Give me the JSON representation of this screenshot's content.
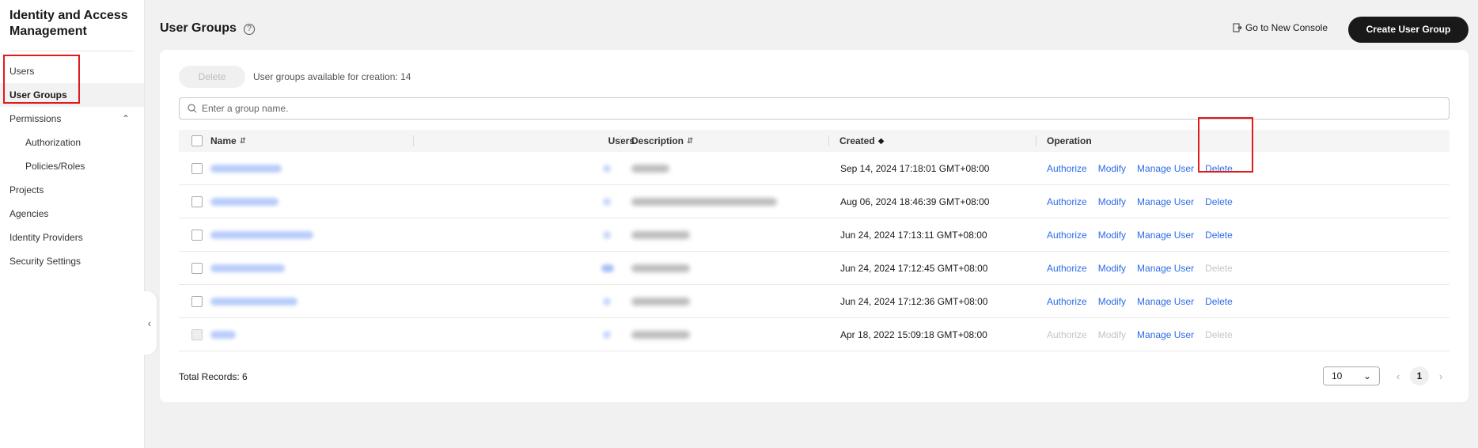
{
  "sidebar": {
    "title": "Identity and Access Management",
    "items": [
      {
        "label": "Users"
      },
      {
        "label": "User Groups"
      },
      {
        "label": "Permissions"
      },
      {
        "label": "Authorization"
      },
      {
        "label": "Policies/Roles"
      },
      {
        "label": "Projects"
      },
      {
        "label": "Agencies"
      },
      {
        "label": "Identity Providers"
      },
      {
        "label": "Security Settings"
      }
    ]
  },
  "header": {
    "title": "User Groups",
    "new_console": "Go to New Console",
    "create_button": "Create User Group"
  },
  "toolbar": {
    "delete_label": "Delete",
    "available": "User groups available for creation: 14"
  },
  "search": {
    "placeholder": "Enter a group name."
  },
  "table": {
    "columns": {
      "name": "Name",
      "users": "Users",
      "description": "Description",
      "created": "Created",
      "operation": "Operation"
    },
    "rows": [
      {
        "created": "Sep 14, 2024 17:18:01 GMT+08:00",
        "ops": [
          "Authorize",
          "Modify",
          "Manage User",
          "Delete"
        ],
        "disabled": [
          false,
          false,
          false,
          false
        ]
      },
      {
        "created": "Aug 06, 2024 18:46:39 GMT+08:00",
        "ops": [
          "Authorize",
          "Modify",
          "Manage User",
          "Delete"
        ],
        "disabled": [
          false,
          false,
          false,
          false
        ]
      },
      {
        "created": "Jun 24, 2024 17:13:11 GMT+08:00",
        "ops": [
          "Authorize",
          "Modify",
          "Manage User",
          "Delete"
        ],
        "disabled": [
          false,
          false,
          false,
          false
        ]
      },
      {
        "created": "Jun 24, 2024 17:12:45 GMT+08:00",
        "ops": [
          "Authorize",
          "Modify",
          "Manage User",
          "Delete"
        ],
        "disabled": [
          false,
          false,
          false,
          true
        ]
      },
      {
        "created": "Jun 24, 2024 17:12:36 GMT+08:00",
        "ops": [
          "Authorize",
          "Modify",
          "Manage User",
          "Delete"
        ],
        "disabled": [
          false,
          false,
          false,
          false
        ]
      },
      {
        "created": "Apr 18, 2022 15:09:18 GMT+08:00",
        "ops": [
          "Authorize",
          "Modify",
          "Manage User",
          "Delete"
        ],
        "disabled": [
          true,
          true,
          false,
          true
        ]
      }
    ]
  },
  "footer": {
    "total": "Total Records: 6",
    "page_size": "10",
    "current_page": "1"
  },
  "colors": {
    "accent": "#2d6be8",
    "primary_button": "#191919",
    "highlight": "#e01b1b"
  }
}
